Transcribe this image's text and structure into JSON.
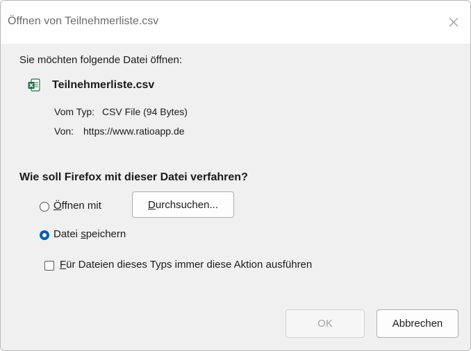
{
  "window": {
    "title": "Öffnen von Teilnehmerliste.csv"
  },
  "dialog": {
    "heading": "Sie möchten folgende Datei öffnen:",
    "file": {
      "icon": "csv-file-icon",
      "name": "Teilnehmerliste.csv",
      "type_label": "Vom Typ:",
      "type_value": "CSV File (94 Bytes)",
      "source_label": "Von:",
      "source_value": "https://www.ratioapp.de"
    },
    "question": "Wie soll Firefox mit dieser Datei verfahren?",
    "options": {
      "open_with": {
        "accel": "Ö",
        "rest": "ffnen mit",
        "selected": false
      },
      "browse_button": {
        "accel": "D",
        "rest": "urchsuchen..."
      },
      "save_file": {
        "before": "Datei ",
        "accel": "s",
        "rest": "peichern",
        "selected": true
      },
      "always_action": {
        "accel": "F",
        "rest": "ür Dateien dieses Typs immer diese Aktion ausführen",
        "checked": false
      }
    },
    "buttons": {
      "ok": "OK",
      "cancel": "Abbrechen"
    }
  },
  "colors": {
    "accent": "#005fb8",
    "excel_green": "#1d7044"
  }
}
